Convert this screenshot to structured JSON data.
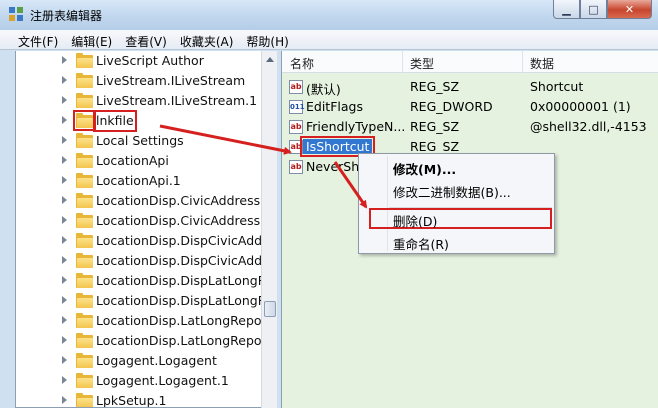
{
  "window": {
    "title": "注册表编辑器",
    "min_glyph": "▁",
    "max_glyph": "□",
    "close_glyph": "✕"
  },
  "menu": [
    "文件(F)",
    "编辑(E)",
    "查看(V)",
    "收藏夹(A)",
    "帮助(H)"
  ],
  "tree": {
    "items": [
      "LiveScript Author",
      "LiveStream.ILiveStream",
      "LiveStream.ILiveStream.1",
      "lnkfile",
      "Local Settings",
      "LocationApi",
      "LocationApi.1",
      "LocationDisp.CivicAddressRe",
      "LocationDisp.CivicAddressRe",
      "LocationDisp.DispCivicAddre",
      "LocationDisp.DispCivicAddre",
      "LocationDisp.DispLatLongRe",
      "LocationDisp.DispLatLongRe",
      "LocationDisp.LatLongReport",
      "LocationDisp.LatLongReport",
      "Logagent.Logagent",
      "Logagent.Logagent.1",
      "LpkSetup.1"
    ],
    "highlighted_index": 3
  },
  "values": {
    "headers": {
      "name": "名称",
      "type": "类型",
      "data": "数据"
    },
    "rows": [
      {
        "icon": "ab",
        "name": "(默认)",
        "type": "REG_SZ",
        "data": "Shortcut"
      },
      {
        "icon": "bin",
        "name": "EditFlags",
        "type": "REG_DWORD",
        "data": "0x00000001 (1)"
      },
      {
        "icon": "ab",
        "name": "FriendlyTypeN...",
        "type": "REG_SZ",
        "data": "@shell32.dll,-4153"
      },
      {
        "icon": "ab",
        "name": "IsShortcut",
        "type": "REG_SZ",
        "data": ""
      },
      {
        "icon": "ab",
        "name": "NeverSho",
        "type": "",
        "data": ""
      }
    ],
    "selected_index": 3
  },
  "context_menu": {
    "modify": "修改(M)...",
    "modify_binary": "修改二进制数据(B)...",
    "delete": "删除(D)",
    "rename": "重命名(R)"
  },
  "colors": {
    "annotation_red": "#d6201f",
    "selection_blue": "#3277d0",
    "value_pane_bg": "#e6f2e0"
  }
}
